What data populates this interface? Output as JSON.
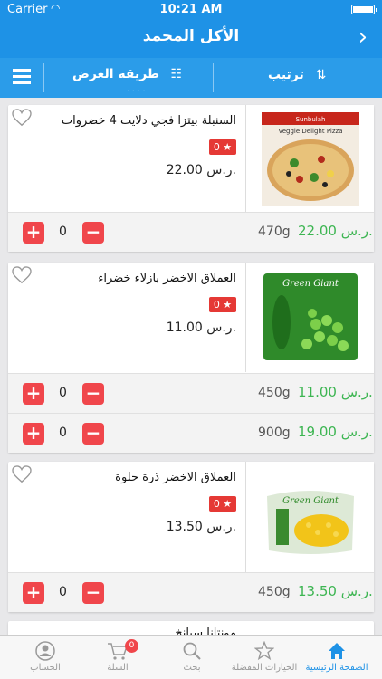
{
  "status": {
    "carrier": "Carrier",
    "time": "10:21 AM"
  },
  "nav": {
    "title": "الأكل المجمد",
    "back_icon": "chevron-right-icon"
  },
  "toolbar": {
    "view_label": "طريقة العرض",
    "view_dots": "....",
    "sort_label": "ترتيب"
  },
  "products": [
    {
      "name": "السنبلة بيتزا فجي دلايت 4 خضروات",
      "rating": "0 ★",
      "price": "22.00 ر.س.",
      "variants": [
        {
          "qty": "0",
          "weight": "470g",
          "price": "22.00 ر.س."
        }
      ]
    },
    {
      "name": "العملاق الاخضر بازلاء خضراء",
      "rating": "0 ★",
      "price": "11.00 ر.س.",
      "variants": [
        {
          "qty": "0",
          "weight": "450g",
          "price": "11.00 ر.س."
        },
        {
          "qty": "0",
          "weight": "900g",
          "price": "19.00 ر.س."
        }
      ]
    },
    {
      "name": "العملاق الاخضر ذرة حلوة",
      "rating": "0 ★",
      "price": "13.50 ر.س.",
      "variants": [
        {
          "qty": "0",
          "weight": "450g",
          "price": "13.50 ر.س."
        }
      ]
    },
    {
      "name": "مونتانا سبانخ"
    }
  ],
  "image_text": {
    "pizza_brand": "Sunbulah",
    "pizza_title": "Veggie Delight Pizza",
    "peas_brand": "Green Giant",
    "corn_brand": "Green Giant"
  },
  "tabbar": {
    "account": "الحساب",
    "cart": "السلة",
    "cart_badge": "0",
    "search": "بحث",
    "favorites": "الخيارات المفضلة",
    "home": "الصفحة الرئيسية"
  },
  "colors": {
    "primary": "#1e92e6",
    "accent_red": "#f0464b",
    "price_green": "#3cb551"
  }
}
